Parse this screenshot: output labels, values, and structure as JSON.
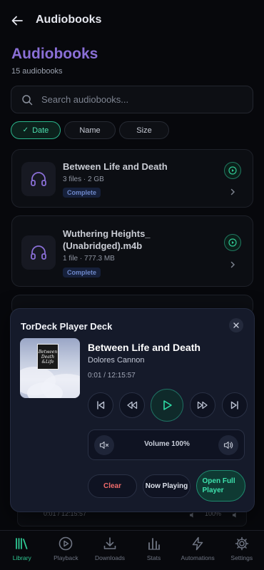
{
  "header": {
    "title": "Audiobooks"
  },
  "page": {
    "title": "Audiobooks",
    "subtitle": "15 audiobooks"
  },
  "search": {
    "placeholder": "Search audiobooks..."
  },
  "sort": {
    "options": [
      "Date",
      "Name",
      "Size"
    ],
    "active": "Date"
  },
  "books": [
    {
      "title": "Between Life and Death",
      "meta": "3 files · 2 GB",
      "status": "Complete"
    },
    {
      "title": "Wuthering Heights_ (Unabridged).m4b",
      "meta": "1 file · 777.3 MB",
      "status": "Complete"
    }
  ],
  "background_player": {
    "time": "0:01 / 12:15:57",
    "volume": "100%"
  },
  "player_deck": {
    "title": "TorDeck Player Deck",
    "track_title": "Between Life and Death",
    "artist": "Dolores Cannon",
    "time": "0:01 / 12:15:57",
    "volume_label": "Volume 100%",
    "cover_text": [
      "Between",
      "Death",
      "&Life"
    ],
    "actions": {
      "clear": "Clear",
      "now_playing": "Now Playing",
      "open_full": "Open Full Player"
    }
  },
  "nav": {
    "items": [
      {
        "label": "Library",
        "icon": "library-icon",
        "active": true
      },
      {
        "label": "Playback",
        "icon": "play-circle-icon"
      },
      {
        "label": "Downloads",
        "icon": "download-icon"
      },
      {
        "label": "Stats",
        "icon": "stats-icon"
      },
      {
        "label": "Automations",
        "icon": "lightning-icon"
      },
      {
        "label": "Settings",
        "icon": "gear-icon"
      }
    ]
  },
  "colors": {
    "accent": "#2fc893",
    "title_purple": "#8a6fd6",
    "clear_red": "#f06b6b",
    "deck_bg": "#151a2a"
  }
}
